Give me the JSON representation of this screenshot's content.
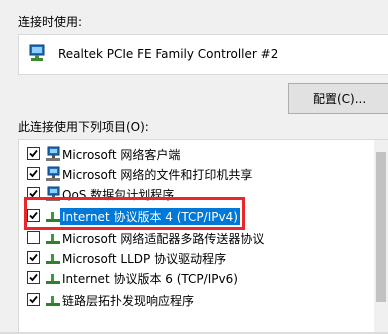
{
  "connect_using_label": "连接时使用:",
  "adapter": {
    "name": "Realtek PCIe FE Family Controller #2",
    "icon": "network-adapter-icon"
  },
  "configure_button": "配置(C)...",
  "items_label": "此连接使用下列项目(O):",
  "items": [
    {
      "label": "Microsoft 网络客户端",
      "checked": true,
      "icon": "network-client-icon"
    },
    {
      "label": "Microsoft 网络的文件和打印机共享",
      "checked": true,
      "icon": "network-client-icon"
    },
    {
      "label": "QoS 数据包计划程序",
      "checked": true,
      "icon": "network-client-icon"
    },
    {
      "label": "Internet 协议版本 4 (TCP/IPv4)",
      "checked": true,
      "icon": "protocol-icon",
      "selected": true
    },
    {
      "label": "Microsoft 网络适配器多路传送器协议",
      "checked": false,
      "icon": "protocol-icon"
    },
    {
      "label": "Microsoft LLDP 协议驱动程序",
      "checked": true,
      "icon": "protocol-icon"
    },
    {
      "label": "Internet 协议版本 6 (TCP/IPv6)",
      "checked": true,
      "icon": "protocol-icon"
    },
    {
      "label": "链路层拓扑发现响应程序",
      "checked": true,
      "icon": "protocol-icon"
    }
  ],
  "colors": {
    "selection": "#0078d7",
    "highlight_border": "#e8262b"
  }
}
